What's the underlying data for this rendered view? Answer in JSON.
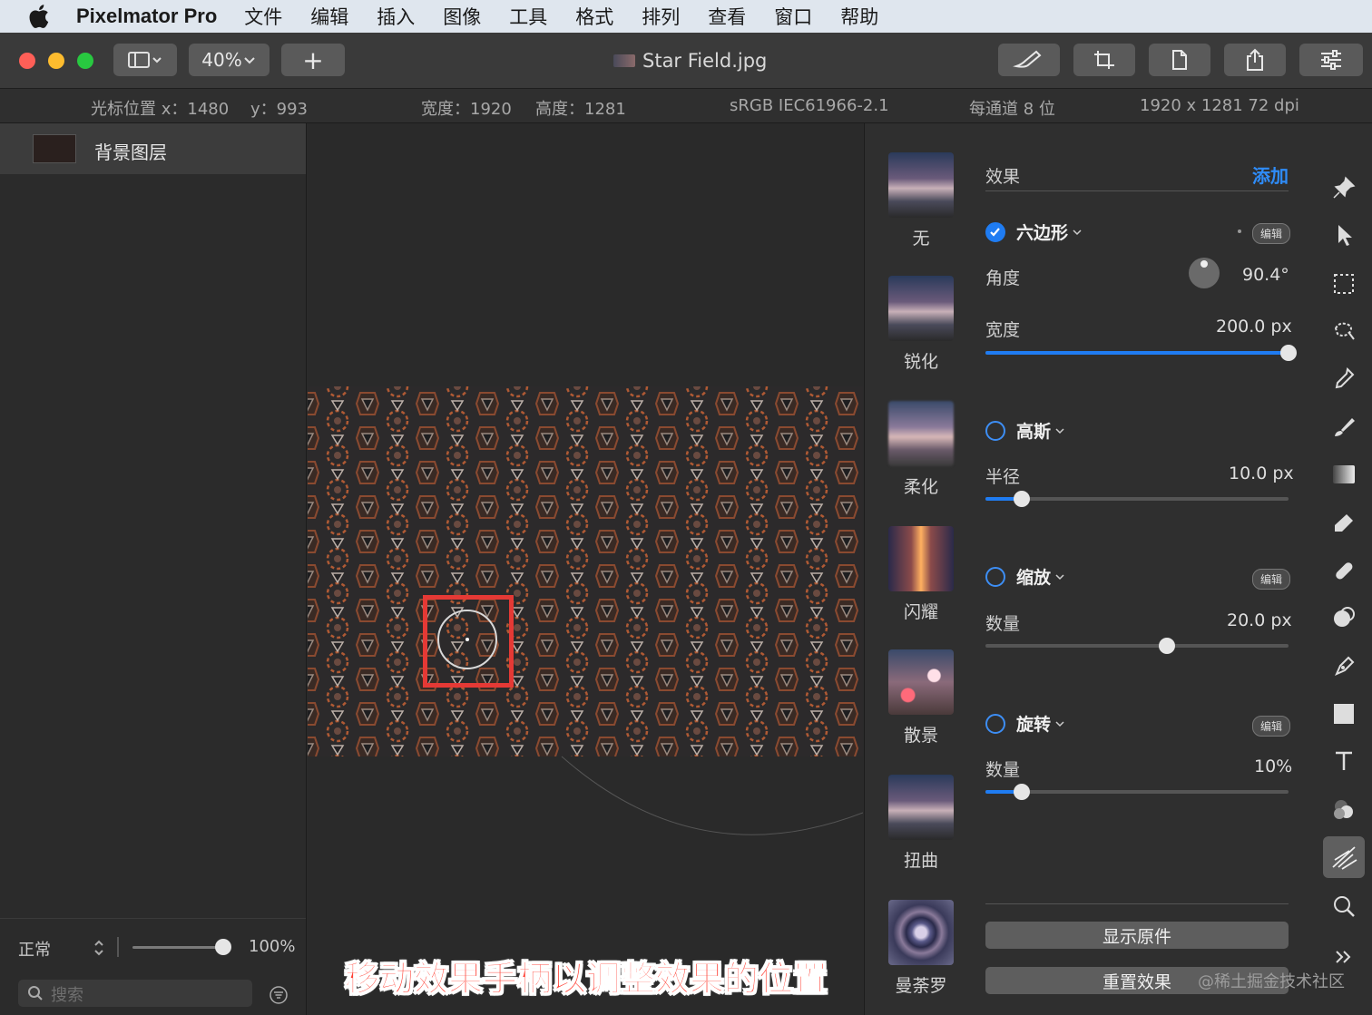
{
  "menubar": {
    "app_name": "Pixelmator Pro",
    "items": [
      "文件",
      "编辑",
      "插入",
      "图像",
      "工具",
      "格式",
      "排列",
      "查看",
      "窗口",
      "帮助"
    ]
  },
  "toolbar": {
    "zoom": "40%",
    "add": "+",
    "document_title": "Star Field.jpg"
  },
  "infobar": {
    "cursor_x_label": "光标位置 x：1480",
    "cursor_y_label": "y：993",
    "width_label": "宽度：1920",
    "height_label": "高度：1281",
    "color_profile": "sRGB IEC61966-2.1",
    "bit_depth": "每通道 8 位",
    "dimensions": "1920 x 1281 72 dpi"
  },
  "layers": {
    "items": [
      {
        "name": "背景图层"
      }
    ],
    "blend_mode": "正常",
    "opacity": "100%",
    "opacity_fraction": 0.95,
    "search_placeholder": "搜索"
  },
  "effects_browser": {
    "items": [
      {
        "label": "无"
      },
      {
        "label": "锐化"
      },
      {
        "label": "柔化"
      },
      {
        "label": "闪耀"
      },
      {
        "label": "散景"
      },
      {
        "label": "扭曲"
      },
      {
        "label": "曼荼罗"
      }
    ]
  },
  "effects_panel": {
    "header": "效果",
    "add": "添加",
    "edit_badge": "编辑",
    "effects": [
      {
        "name": "六边形",
        "enabled": true,
        "params": [
          {
            "label": "角度",
            "value": "90.4°"
          },
          {
            "label": "宽度",
            "value": "200.0 px",
            "fraction": 1.0
          }
        ]
      },
      {
        "name": "高斯",
        "enabled": false,
        "params": [
          {
            "label": "半径",
            "value": "10.0 px",
            "fraction": 0.12
          }
        ]
      },
      {
        "name": "缩放",
        "enabled": false,
        "params": [
          {
            "label": "数量",
            "value": "20.0 px",
            "fraction": 0.6
          }
        ]
      },
      {
        "name": "旋转",
        "enabled": false,
        "params": [
          {
            "label": "数量",
            "value": "10%",
            "fraction": 0.12
          }
        ]
      }
    ],
    "show_original": "显示原件",
    "reset": "重置效果"
  },
  "canvas": {
    "caption": "移动效果手柄以调整效果的位置"
  },
  "watermark": "@稀土掘金技术社区",
  "colors": {
    "accent": "#1f7cf2",
    "highlight_box": "#e53935",
    "caption": "#ff3b2f"
  }
}
